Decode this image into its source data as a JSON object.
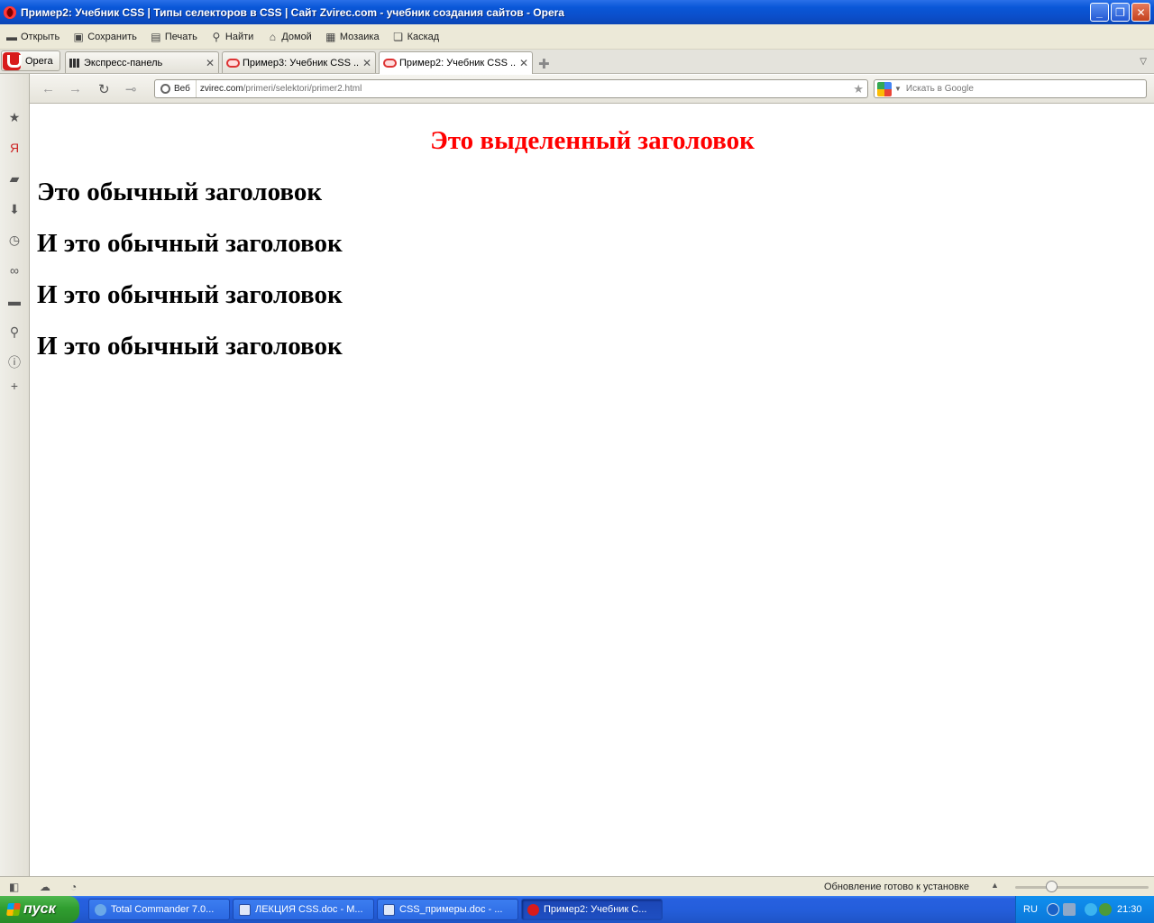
{
  "window": {
    "title": "Пример2: Учебник CSS | Типы селекторов в CSS | Сайт Zvirec.com - учебник создания сайтов - Opera"
  },
  "toolbar": {
    "items": [
      {
        "label": "Открыть",
        "icon": "folder-icon"
      },
      {
        "label": "Сохранить",
        "icon": "save-icon"
      },
      {
        "label": "Печать",
        "icon": "print-icon"
      },
      {
        "label": "Найти",
        "icon": "search-icon"
      },
      {
        "label": "Домой",
        "icon": "home-icon"
      },
      {
        "label": "Мозаика",
        "icon": "tile-icon"
      },
      {
        "label": "Каскад",
        "icon": "cascade-icon"
      }
    ]
  },
  "tabs": {
    "opera_label": "Opera",
    "items": [
      {
        "label": "Экспресс-панель"
      },
      {
        "label": "Пример3: Учебник CSS ..."
      },
      {
        "label": "Пример2: Учебник CSS ..."
      }
    ]
  },
  "address": {
    "badge": "Веб",
    "url_host": "zvirec.com",
    "url_path": "/primeri/selektori/primer2.html",
    "search_placeholder": "Искать в Google"
  },
  "content": {
    "special_heading": "Это выделенный заголовок",
    "headings": [
      "Это обычный заголовок",
      "И это обычный заголовок",
      "И это обычный заголовок",
      "И это обычный заголовок"
    ],
    "colors": {
      "special": "#ff0000",
      "normal": "#000000"
    }
  },
  "status": {
    "text": "Обновление готово к установке"
  },
  "taskbar": {
    "start_label": "пуск",
    "tasks": [
      {
        "label": "Total Commander 7.0..."
      },
      {
        "label": "ЛЕКЦИЯ CSS.doc - M..."
      },
      {
        "label": "CSS_примеры.doc - ..."
      },
      {
        "label": "Пример2: Учебник С..."
      }
    ],
    "lang": "RU",
    "clock": "21:30"
  }
}
